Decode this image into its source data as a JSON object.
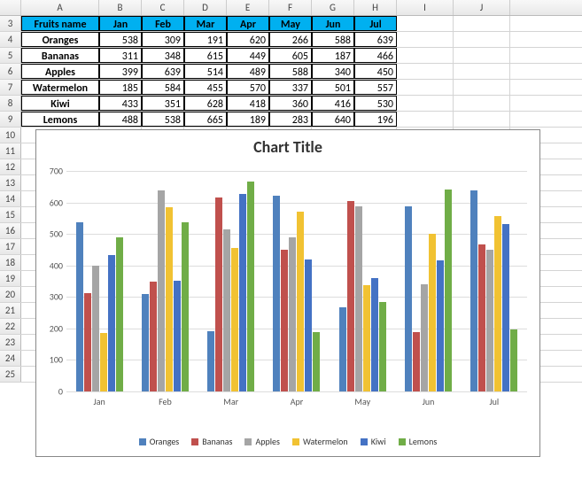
{
  "columns": [
    "A",
    "B",
    "C",
    "D",
    "E",
    "F",
    "G",
    "H",
    "I",
    "J"
  ],
  "rownums": [
    3,
    4,
    5,
    6,
    7,
    8,
    9,
    10,
    11,
    12,
    13,
    14,
    15,
    16,
    17,
    18,
    19,
    20,
    21,
    22,
    23,
    24,
    25
  ],
  "headerRow": [
    "Fruits name",
    "Jan",
    "Feb",
    "Mar",
    "Apr",
    "May",
    "Jun",
    "Jul"
  ],
  "dataRows": [
    {
      "name": "Oranges",
      "vals": [
        538,
        309,
        191,
        620,
        266,
        588,
        639
      ]
    },
    {
      "name": "Bananas",
      "vals": [
        311,
        348,
        615,
        449,
        605,
        187,
        466
      ]
    },
    {
      "name": "Apples",
      "vals": [
        399,
        639,
        514,
        489,
        588,
        340,
        450
      ]
    },
    {
      "name": "Watermelon",
      "vals": [
        185,
        584,
        455,
        570,
        337,
        501,
        557
      ]
    },
    {
      "name": "Kiwi",
      "vals": [
        433,
        351,
        628,
        418,
        360,
        416,
        530
      ]
    },
    {
      "name": "Lemons",
      "vals": [
        488,
        538,
        665,
        189,
        283,
        640,
        196
      ]
    }
  ],
  "chart_data": {
    "type": "bar",
    "title": "Chart Title",
    "categories": [
      "Jan",
      "Feb",
      "Mar",
      "Apr",
      "May",
      "Jun",
      "Jul"
    ],
    "series": [
      {
        "name": "Oranges",
        "color": "#4f81bd",
        "values": [
          538,
          309,
          191,
          620,
          266,
          588,
          639
        ]
      },
      {
        "name": "Bananas",
        "color": "#c0504d",
        "values": [
          311,
          348,
          615,
          449,
          605,
          187,
          466
        ]
      },
      {
        "name": "Apples",
        "color": "#9bbb59",
        "dispColor": "#a5a5a5",
        "values": [
          399,
          639,
          514,
          489,
          588,
          340,
          450
        ]
      },
      {
        "name": "Watermelon",
        "color": "#f1c232",
        "values": [
          185,
          584,
          455,
          570,
          337,
          501,
          557
        ]
      },
      {
        "name": "Kiwi",
        "color": "#4472c4",
        "values": [
          433,
          351,
          628,
          418,
          360,
          416,
          530
        ]
      },
      {
        "name": "Lemons",
        "color": "#70ad47",
        "values": [
          488,
          538,
          665,
          189,
          283,
          640,
          196
        ]
      }
    ],
    "ylim": [
      0,
      700
    ],
    "yticks": [
      0,
      100,
      200,
      300,
      400,
      500,
      600,
      700
    ],
    "xlabel": "",
    "ylabel": ""
  },
  "seriesColors": [
    "#4f81bd",
    "#c0504d",
    "#a5a5a5",
    "#f1c232",
    "#4472c4",
    "#70ad47"
  ]
}
